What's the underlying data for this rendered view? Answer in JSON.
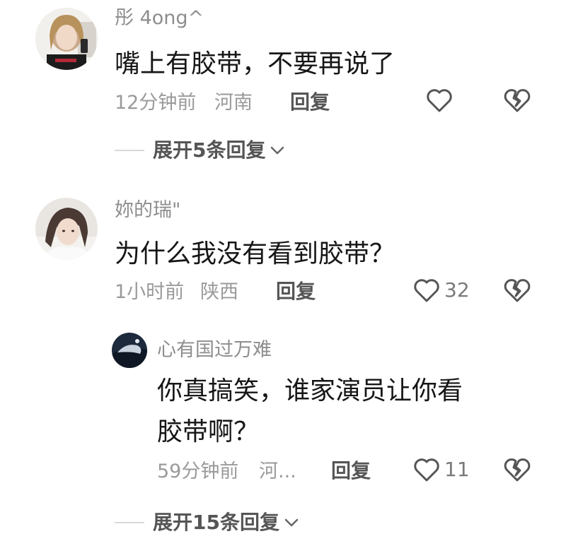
{
  "comments": [
    {
      "username": "彤 4ong^",
      "text": "嘴上有胶带，不要再说了",
      "time": "12分钟前",
      "location": "河南",
      "reply_label": "回复",
      "like_count": "",
      "expand_label": "展开5条回复",
      "avatar_icon": "user-avatar"
    },
    {
      "username": "妳的瑞\"",
      "text": "为什么我没有看到胶带？",
      "time": "1小时前",
      "location": "陕西",
      "reply_label": "回复",
      "like_count": "32",
      "avatar_icon": "user-avatar",
      "reply": {
        "username": "心有国过万难",
        "text_line1": "你真搞笑，谁家演员让你看",
        "text_line2": "胶带啊？",
        "time": "59分钟前",
        "location": "河...",
        "reply_label": "回复",
        "like_count": "11",
        "avatar_icon": "user-avatar"
      },
      "expand_label": "展开15条回复"
    }
  ],
  "icons": {
    "like": "heart-outline-icon",
    "dislike": "broken-heart-icon",
    "expand": "chevron-down-icon"
  },
  "colors": {
    "username": "#8e8e8e",
    "body": "#161616",
    "meta": "#9a9a9a",
    "action": "#555555",
    "icon": "#555555"
  }
}
